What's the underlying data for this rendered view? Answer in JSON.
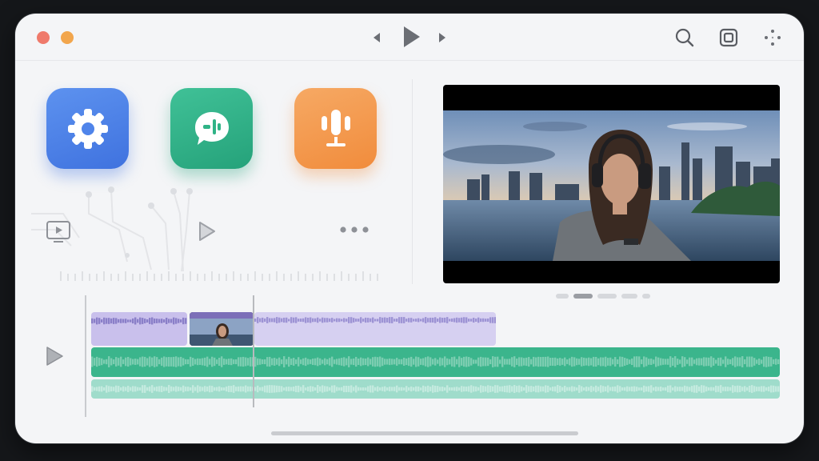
{
  "window": {
    "controls": [
      "close",
      "minimize"
    ],
    "transport": {
      "icons": [
        "skip-back-icon",
        "play-icon",
        "skip-forward-icon"
      ]
    },
    "toolbar": {
      "icons": [
        "search-icon",
        "fullscreen-icon",
        "more-icon"
      ]
    }
  },
  "apps": [
    {
      "name": "settings",
      "icon": "gear-icon",
      "color": "#4a80e8"
    },
    {
      "name": "chat",
      "icon": "chat-bubble-icon",
      "color": "#2fb386"
    },
    {
      "name": "audio",
      "icon": "microphone-icon",
      "color": "#f39a4d"
    }
  ],
  "media_controls": {
    "icons": [
      "screen-play-icon",
      "play-outline-icon",
      "more-dots-icon"
    ]
  },
  "video": {
    "pages": 5,
    "active_page": 2
  },
  "timeline": {
    "tracks": [
      "video-clips",
      "audio-waveform",
      "audio-waveform-secondary"
    ],
    "colors": {
      "clip": "#c9c0ec",
      "audio": "#3bb58c",
      "audio_light": "#9fdccb"
    }
  }
}
